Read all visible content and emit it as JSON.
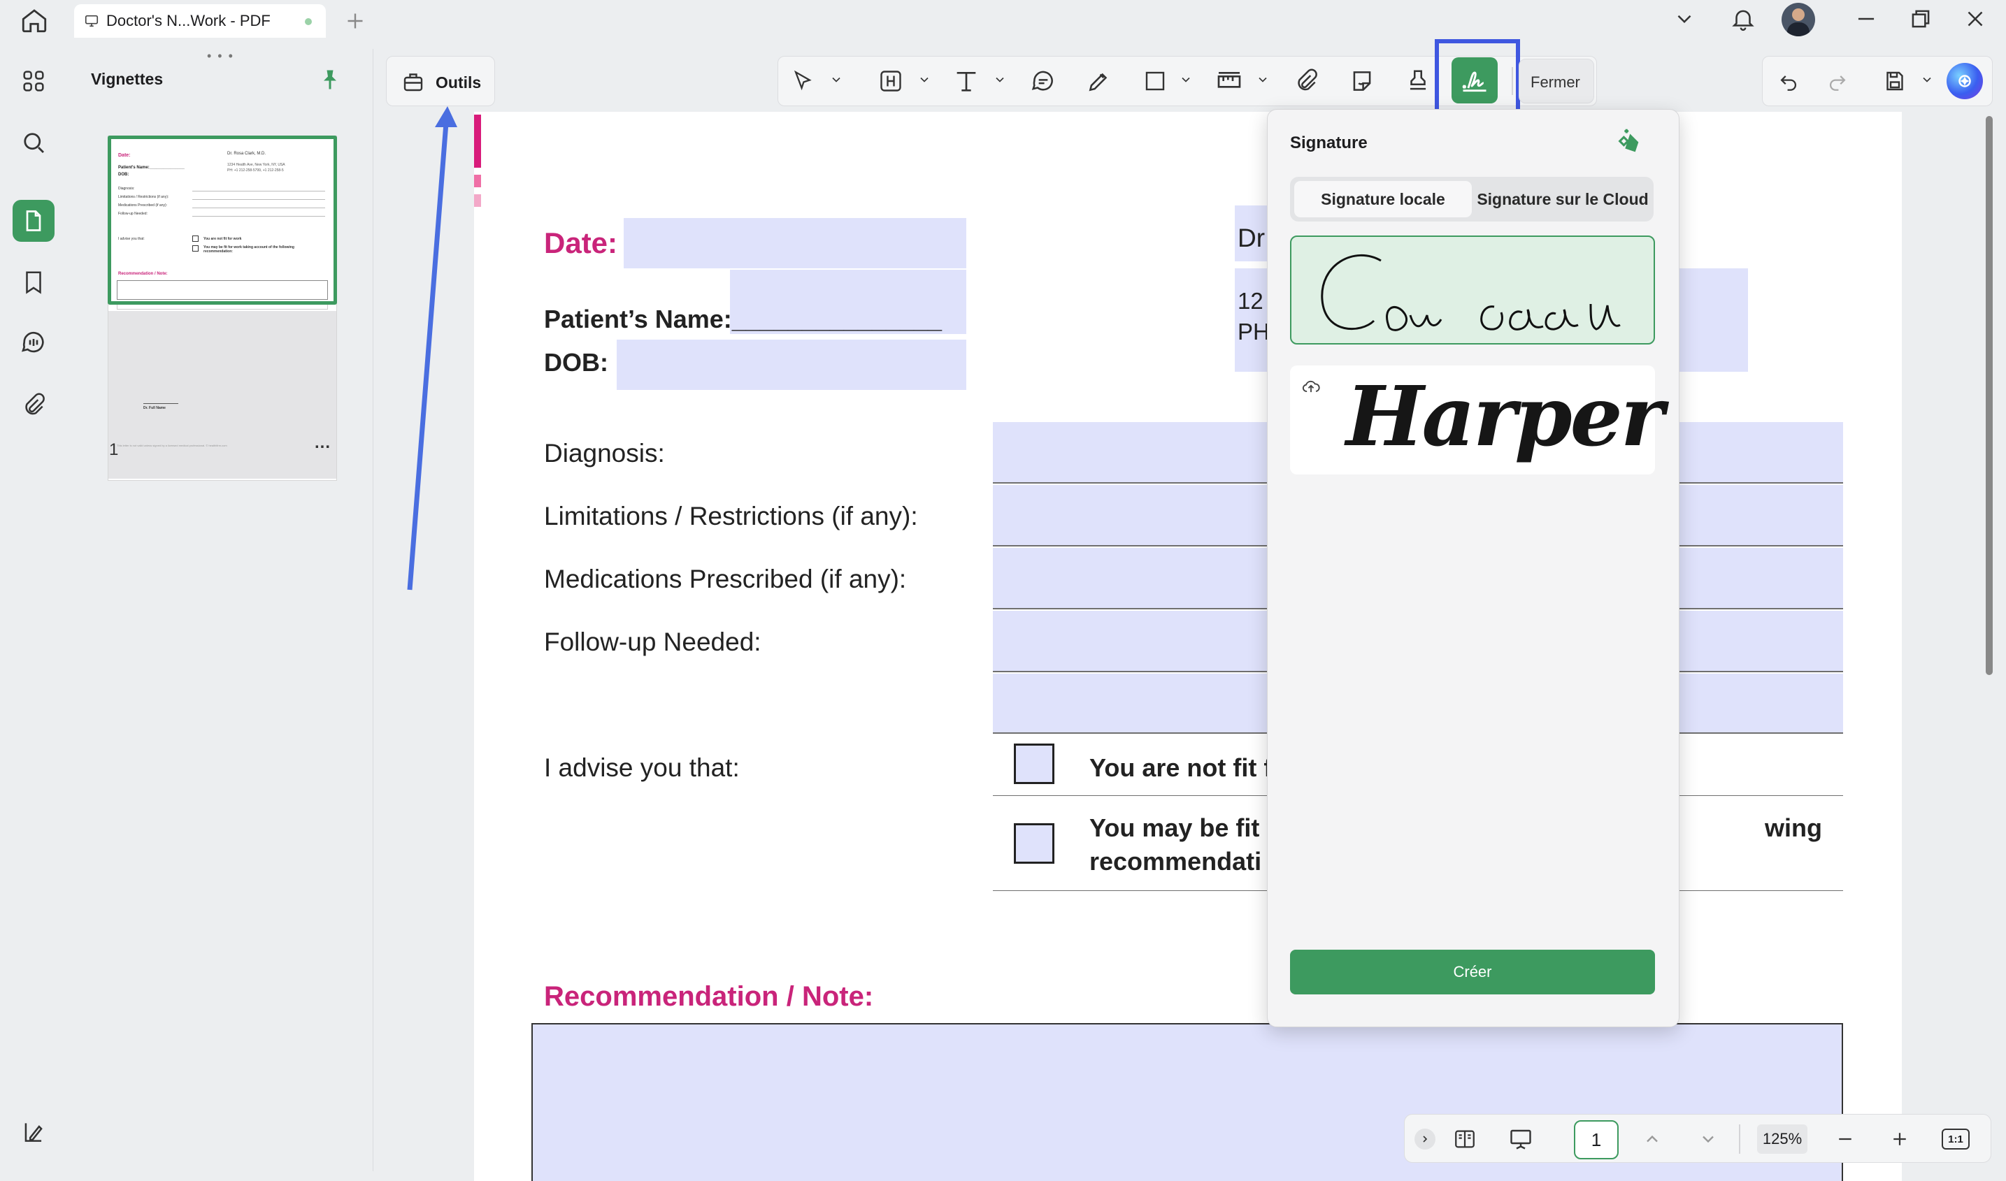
{
  "tab": {
    "title": "Doctor's N...Work - PDF"
  },
  "thumbnails": {
    "title": "Vignettes",
    "page_number": "1",
    "more": "..."
  },
  "toolbar": {
    "tools_label": "Outils",
    "close_label": "Fermer"
  },
  "document": {
    "date_label": "Date:",
    "patient_label": "Patient’s Name:_______________",
    "dob_label": "DOB:",
    "doctor_fragment": "Dr",
    "address_fragment": "12",
    "phone_fragment": "PH",
    "diagnosis": "Diagnosis:",
    "limitations": "Limitations / Restrictions (if any):",
    "medications": "Medications Prescribed (if any):",
    "followup": "Follow-up Needed:",
    "advise": "I advise you that:",
    "option1": "You are not fit f",
    "option2_line1": "You may be fit f",
    "option2_right": "wing",
    "option2_line2": "recommendati",
    "recommendation": "Recommendation / Note:"
  },
  "thumbnail_text": {
    "date": "Date:",
    "doctor": "Dr. Rosa Clark, M.D.",
    "address": "1234 Health Ave, New York, NY, USA",
    "phone": "PH: +1 212-258-5799, +1 212-258-5",
    "patient": "Patient's Name:_______________",
    "dob": "DOB:",
    "diagnosis": "Diagnosis:",
    "limitations": "Limitations / Restrictions (if any):",
    "medications": "Medications Prescribed (if any):",
    "followup": "Follow-up Needed:",
    "advise": "I advise you that:",
    "opt1": "You are not fit for work",
    "opt2": "You may be fit for work taking account of the following recommendation:",
    "recommendation": "Recommendation / Note:",
    "signame": "Dr. Full Name",
    "footer": "This letter is not valid unless signed by a licensed medical professional. © healthfirm.com"
  },
  "signature_panel": {
    "title": "Signature",
    "tab_local": "Signature locale",
    "tab_cloud": "Signature sur le Cloud",
    "signature2_text": "Harper",
    "create_label": "Créer"
  },
  "bottom_bar": {
    "page_input": "1",
    "zoom": "125%",
    "fit": "1:1"
  },
  "colors": {
    "accent": "#3d9a5f",
    "pink": "#c9247a",
    "field": "#dfe2fb",
    "highlight_box": "#3f57e0",
    "arrow": "#4a6ee0"
  }
}
